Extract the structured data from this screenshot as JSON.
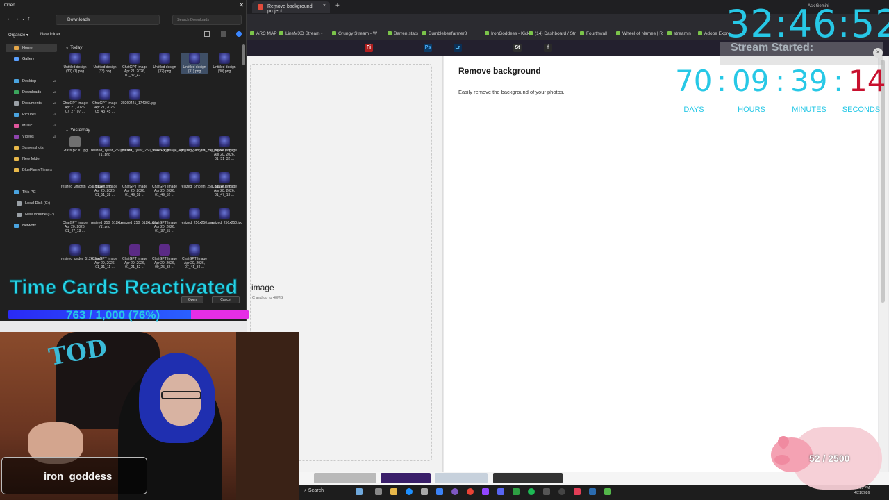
{
  "browser": {
    "tab_active": "Remove background project",
    "tab_new": "+",
    "bookmarks": [
      "ARC MAP",
      "LineMXD Stream -",
      "Grungy Stream - W",
      "Barren stats",
      "Bumblebeefarmer8",
      "IronGoddess - KickB",
      "(14) Dashboard / Str",
      "Fourthwall",
      "Wheel of Names | R",
      "streamin",
      "Adobe Expre"
    ],
    "gemini": "Ask Gemini",
    "adobe_icons": [
      "Fi",
      "Ps",
      "Lr",
      "St",
      "f"
    ]
  },
  "page": {
    "title": "Remove background",
    "description": "Easily remove the background of your photos.",
    "upload_label": "image",
    "upload_hint": "C and up to 40MB"
  },
  "overlay": {
    "timer": "32:46:52",
    "stream_started": "Stream Started:",
    "countdown": {
      "days": "70",
      "hours": "09",
      "minutes": "39",
      "seconds": "14"
    },
    "labels": {
      "days": "DAYS",
      "hours": "HOURS",
      "minutes": "MINUTES",
      "seconds": "SECONDS"
    },
    "close_icon": "×",
    "colors": {
      "accent": "#27c8e6",
      "seconds": "#c8102e"
    }
  },
  "dialog": {
    "title": "Open",
    "close": "✕",
    "nav": "← → ⌄ ↑",
    "path": "Downloads",
    "search_placeholder": "Search Downloads",
    "organize": "Organize ▾",
    "new_folder": "New folder",
    "sidebar": [
      {
        "label": "Home",
        "icon": "home-icon"
      },
      {
        "label": "Gallery",
        "icon": "gallery-icon"
      },
      {
        "label": "Desktop",
        "icon": "desktop-icon"
      },
      {
        "label": "Downloads",
        "icon": "download-icon"
      },
      {
        "label": "Documents",
        "icon": "documents-icon"
      },
      {
        "label": "Pictures",
        "icon": "pictures-icon"
      },
      {
        "label": "Music",
        "icon": "music-icon"
      },
      {
        "label": "Videos",
        "icon": "videos-icon"
      },
      {
        "label": "Screenshots",
        "icon": "folder-icon"
      },
      {
        "label": "New folder",
        "icon": "folder-icon"
      },
      {
        "label": "BlueFlameTimers",
        "icon": "folder-icon"
      },
      {
        "label": "This PC",
        "icon": "pc-icon"
      },
      {
        "label": "Local Disk (C:)",
        "icon": "disk-icon"
      },
      {
        "label": "New Volume (G:)",
        "icon": "disk-icon"
      },
      {
        "label": "Network",
        "icon": "network-icon"
      }
    ],
    "groups": {
      "today": "Today",
      "yesterday": "Yesterday"
    },
    "files_today": [
      "Untitled design (30) (1).png",
      "Untitled design (33).png",
      "ChatGPT Image Apr 21, 2026, 07_37_42 ...",
      "Untitled design (32).png",
      "Untitled design (31).png",
      "Untitled design (30).png",
      "ChatGPT Image Apr 21, 2026, 07_27_07 ...",
      "ChatGPT Image Apr 21, 2026, 05_43_45 ...",
      "20260421_174003.jpg"
    ],
    "files_yesterday": [
      "Grass pic #1.jpg",
      "resized_1year_250_512kb (1).png",
      "resized_1year_250_512kb.png",
      "ChatGPT_Image_Apr_20_2026_01_29_17_P...",
      "resized_9month_250_512kb.png",
      "ChatGPT Image Apr 20, 2026, 01_51_32 ...",
      "resized_2month_250_512kb.png",
      "ChatGPT Image Apr 20, 2026, 01_51_32 ...",
      "ChatGPT Image Apr 20, 2026, 01_49_52 ...",
      "ChatGPT Image Apr 20, 2026, 01_49_52 ...",
      "resized_6month_250_512kb.png",
      "ChatGPT Image Apr 20, 2026, 01_47_13 ...",
      "ChatGPT Image Apr 20, 2026, 01_47_13 ...",
      "resized_250_512kb (1).png",
      "resized_250_512kb.png",
      "ChatGPT Image Apr 20, 2026, 01_37_55 ...",
      "resized_250x250.png",
      "resized_250x250.jpg",
      "resized_under_512kb.jpg",
      "ChatGPT Image Apr 20, 2026, 01_31_11 ...",
      "ChatGPT Image Apr 20, 2026, 01_21_52 ...",
      "ChatGPT Image Apr 20, 2026, 09_25_32 ...",
      "ChatGPT Image Apr 20, 2026, 07_41_34 ..."
    ],
    "open_button": "Open",
    "cancel_button": "Cancel"
  },
  "time_cards": {
    "title": "Time Cards Reactivated",
    "count": "763 / 1,000 (76%)",
    "progress": 0.763
  },
  "webcam": {
    "username": "iron_goddess",
    "shirt_text": "TOD"
  },
  "taskbar": {
    "search": "Search",
    "time": "7:39 PM",
    "date": "4/21/2026"
  },
  "pig_bank": {
    "count": "52 / 2500"
  }
}
